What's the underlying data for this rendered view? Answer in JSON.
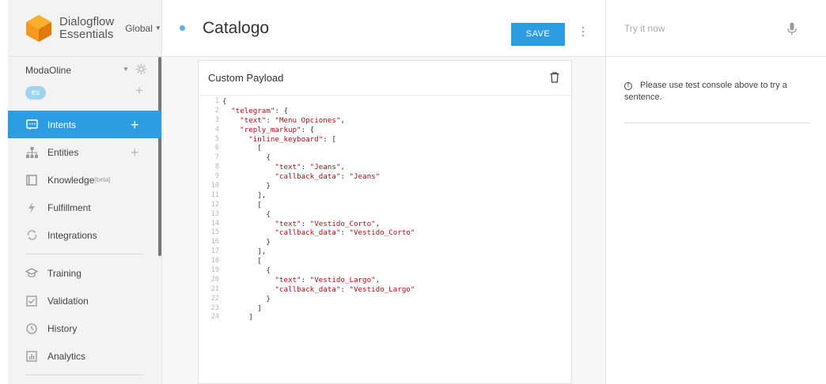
{
  "sidebar": {
    "brand_line1": "Dialogflow",
    "brand_line2": "Essentials",
    "region": "Global",
    "agent_name": "ModaOline",
    "language": "es",
    "nav": [
      {
        "label": "Intents",
        "icon": "chat-icon",
        "active": true,
        "add": true
      },
      {
        "label": "Entities",
        "icon": "hierarchy-icon",
        "active": false,
        "add": true
      },
      {
        "label": "Knowledge",
        "icon": "book-icon",
        "active": false,
        "add": false,
        "badge": "[beta]"
      },
      {
        "label": "Fulfillment",
        "icon": "bolt-icon",
        "active": false,
        "add": false
      },
      {
        "label": "Integrations",
        "icon": "sync-icon",
        "active": false,
        "add": false
      },
      {
        "label": "Training",
        "icon": "graduation-cap-icon",
        "active": false,
        "add": false
      },
      {
        "label": "Validation",
        "icon": "checkbox-icon",
        "active": false,
        "add": false
      },
      {
        "label": "History",
        "icon": "clock-icon",
        "active": false,
        "add": false
      },
      {
        "label": "Analytics",
        "icon": "bar-chart-icon",
        "active": false,
        "add": false
      }
    ]
  },
  "main": {
    "intent_title": "Catalogo",
    "save_label": "SAVE",
    "card_title": "Custom Payload",
    "code_lines": [
      "{",
      "  \"telegram\": {",
      "    \"text\": \"Menu Opciones\",",
      "    \"reply_markup\": {",
      "      \"inline_keyboard\": [",
      "        [",
      "          {",
      "            \"text\": \"Jeans\",",
      "            \"callback_data\": \"Jeans\"",
      "          }",
      "        ],",
      "        [",
      "          {",
      "            \"text\": \"Vestido_Corto\",",
      "            \"callback_data\": \"Vestido_Corto\"",
      "          }",
      "        ],",
      "        [",
      "          {",
      "            \"text\": \"Vestido_Largo\",",
      "            \"callback_data\": \"Vestido_Largo\"",
      "          }",
      "        ]",
      "      ]"
    ]
  },
  "right": {
    "try_placeholder": "Try it now",
    "hint": "Please use test console above to try a sentence."
  },
  "colors": {
    "accent": "#2c9de2",
    "string": "#a31515",
    "logo_orange": "#f49b1f"
  }
}
